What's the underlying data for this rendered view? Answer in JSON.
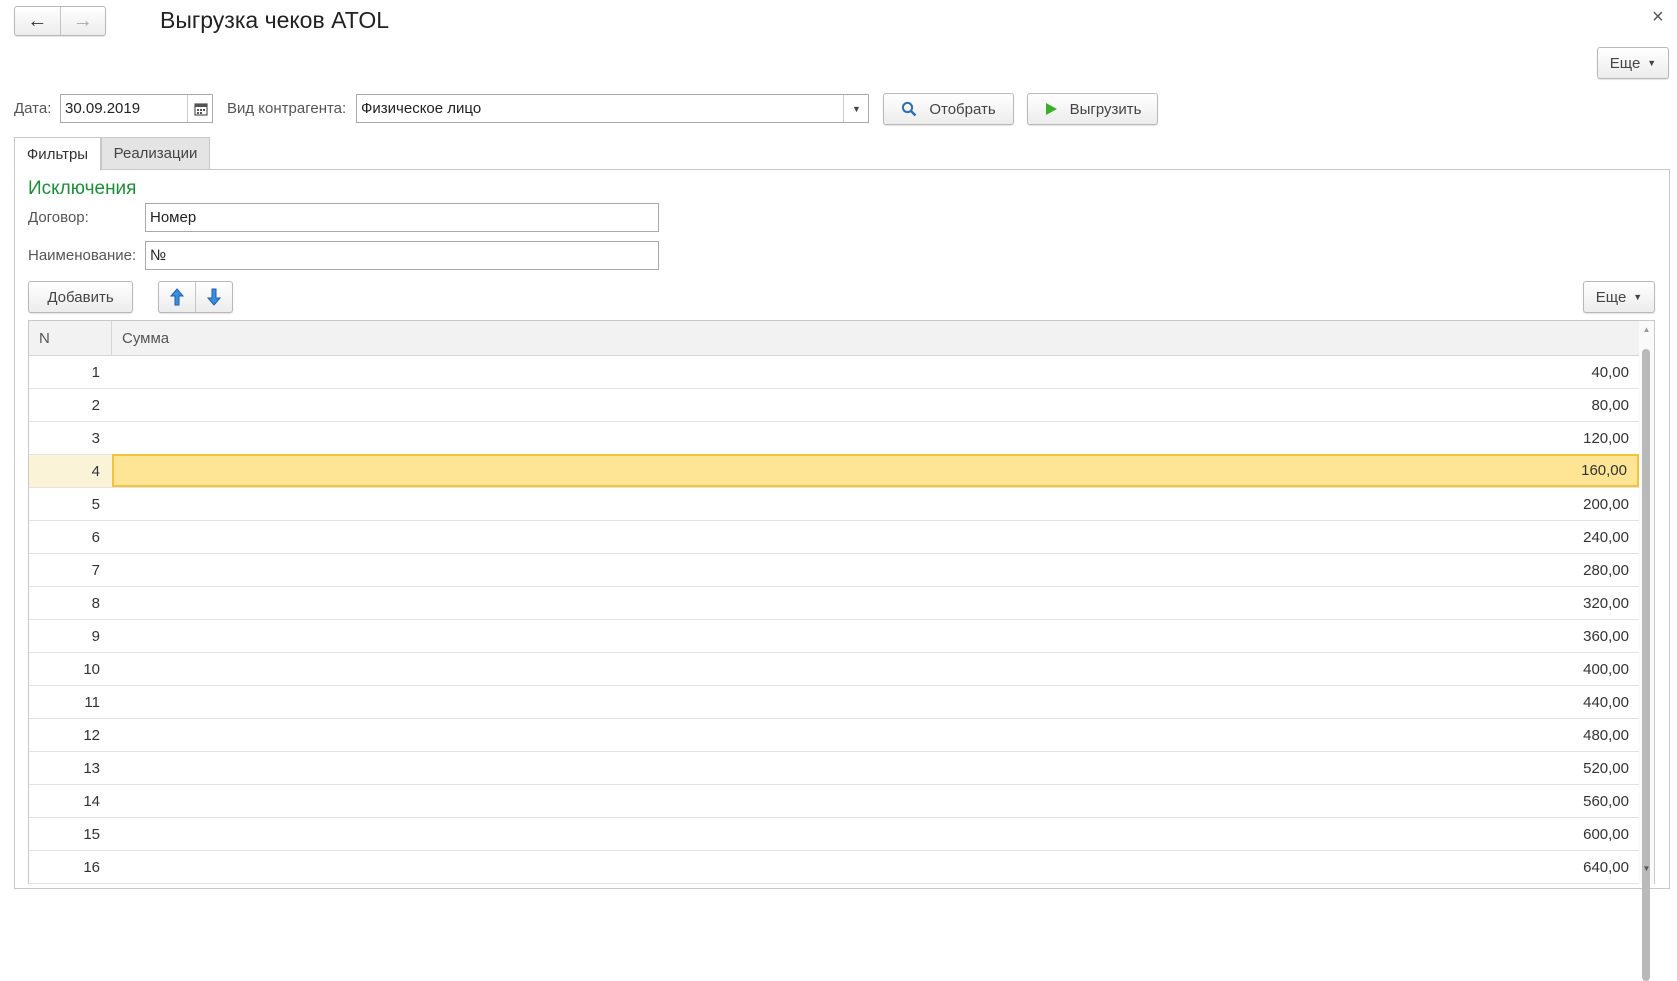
{
  "window": {
    "title": "Выгрузка чеков ATOL",
    "back_icon": "←",
    "forward_icon": "→",
    "close_icon": "×",
    "more_label": "Еще"
  },
  "controls": {
    "date_label": "Дата:",
    "date_value": "30.09.2019",
    "kontragent_label": "Вид контрагента:",
    "kontragent_value": "Физическое лицо",
    "select_button": "Отобрать",
    "export_button": "Выгрузить"
  },
  "tabs": [
    {
      "label": "Фильтры",
      "active": true
    },
    {
      "label": "Реализации",
      "active": false
    }
  ],
  "filters": {
    "section_title": "Исключения",
    "contract_label": "Договор:",
    "contract_value": "Номер",
    "name_label": "Наименование:",
    "name_value": "№",
    "add_button": "Добавить",
    "more_label": "Еще"
  },
  "table": {
    "columns": [
      "N",
      "Сумма"
    ],
    "active_row": 4,
    "rows": [
      {
        "n": "1",
        "sum": "40,00"
      },
      {
        "n": "2",
        "sum": "80,00"
      },
      {
        "n": "3",
        "sum": "120,00"
      },
      {
        "n": "4",
        "sum": "160,00"
      },
      {
        "n": "5",
        "sum": "200,00"
      },
      {
        "n": "6",
        "sum": "240,00"
      },
      {
        "n": "7",
        "sum": "280,00"
      },
      {
        "n": "8",
        "sum": "320,00"
      },
      {
        "n": "9",
        "sum": "360,00"
      },
      {
        "n": "10",
        "sum": "400,00"
      },
      {
        "n": "11",
        "sum": "440,00"
      },
      {
        "n": "12",
        "sum": "480,00"
      },
      {
        "n": "13",
        "sum": "520,00"
      },
      {
        "n": "14",
        "sum": "560,00"
      },
      {
        "n": "15",
        "sum": "600,00"
      },
      {
        "n": "16",
        "sum": "640,00"
      }
    ]
  },
  "colors": {
    "section_title": "#1f8c3c",
    "active_row_fill": "#fde595",
    "active_row_border": "#f0c53c",
    "play_icon": "#3dae2b",
    "arrow_icon": "#2a7fd4"
  }
}
